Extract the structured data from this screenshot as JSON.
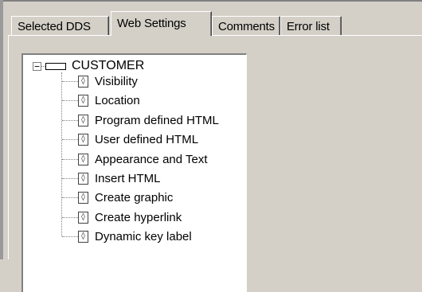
{
  "tabs": [
    {
      "label": "Selected DDS"
    },
    {
      "label": "Web Settings"
    },
    {
      "label": "Comments"
    },
    {
      "label": "Error list"
    }
  ],
  "tree": {
    "expander_glyph": "−",
    "root": {
      "label": "CUSTOMER",
      "icon": "record-icon"
    },
    "field_glyph": "◊",
    "children": [
      {
        "label": "Visibility"
      },
      {
        "label": "Location"
      },
      {
        "label": "Program defined HTML"
      },
      {
        "label": "User defined HTML"
      },
      {
        "label": "Appearance and Text"
      },
      {
        "label": "Insert HTML"
      },
      {
        "label": "Create graphic"
      },
      {
        "label": "Create hyperlink"
      },
      {
        "label": "Dynamic key label"
      }
    ]
  },
  "colors": {
    "face": "#d4d0c8",
    "tree_bg": "#ffffff",
    "shadow": "#808080"
  }
}
